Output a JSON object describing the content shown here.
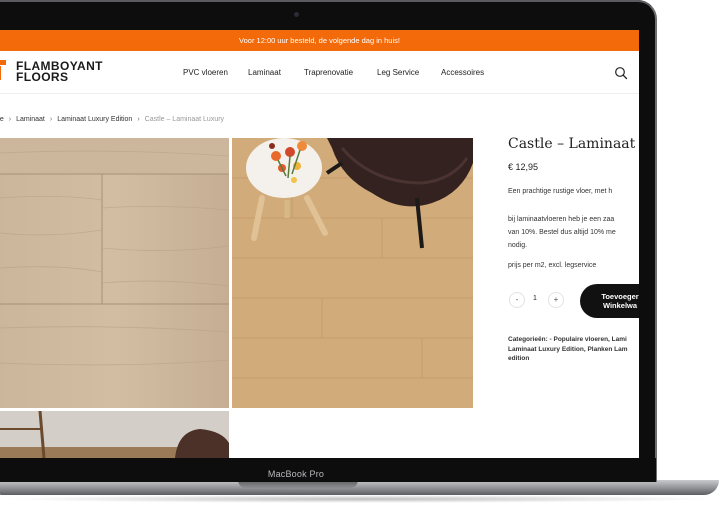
{
  "device": {
    "label": "MacBook Pro"
  },
  "promo_bar": {
    "text": "Voor 12:00 uur besteld, de volgende dag in huis!"
  },
  "logo": {
    "line1": "FLAMBOYANT",
    "line2": "FLOORS"
  },
  "nav": {
    "items": [
      "PVC vloeren",
      "Laminaat",
      "Traprenovatie",
      "Leg Service",
      "Accessoires"
    ]
  },
  "icons": {
    "search": "search-icon",
    "minus": "minus-icon",
    "plus": "plus-icon"
  },
  "breadcrumb": {
    "items": [
      "me",
      "Laminaat",
      "Laminaat Luxury Edition",
      "Castle – Laminaat Luxury"
    ],
    "separator": "›"
  },
  "product": {
    "title": "Castle – Laminaat Lu",
    "price": "€ 12,95",
    "desc1": "Een prachtige rustige vloer, met h",
    "desc2_line1": "bij laminaatvloeren heb je een zaa",
    "desc2_line2": "van 10%. Bestel dus altijd 10% me",
    "desc2_line3": "nodig.",
    "desc3": "prijs per m2, excl. legservice",
    "quantity": "1",
    "qty_minus": "-",
    "qty_plus": "+",
    "cart_line1": "Toevoeger",
    "cart_line2": "Winkelwa",
    "categories_line1": "Categorieën: - Populaire vloeren, Lami",
    "categories_line2": "Laminaat Luxury Edition, Planken Lam",
    "categories_line3": "edition"
  },
  "colors": {
    "accent": "#f26a0a",
    "button": "#111111"
  }
}
